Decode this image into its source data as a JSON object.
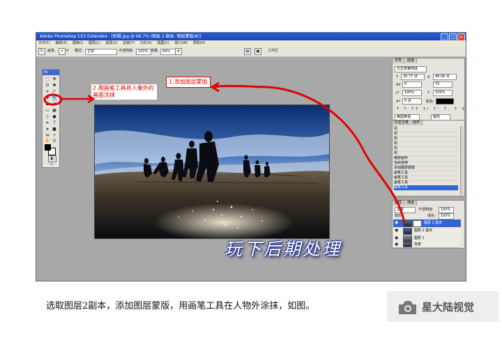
{
  "window": {
    "title": "Adobe Photoshop CS3 Extended - [拍摄.jpg @ 66.7% (图层 2 副本, 图层蒙版/8)]",
    "menu": [
      "文件(F)",
      "编辑(E)",
      "图像(I)",
      "图层(L)",
      "选择(S)",
      "滤镜(T)",
      "分析(A)",
      "视图(V)",
      "窗口(W)",
      "帮助(H)"
    ],
    "controls": {
      "minimize": "_",
      "maximize": "□",
      "close": "×"
    }
  },
  "options_bar": {
    "brush_label": "画笔:",
    "brush_size": "4",
    "mode_label": "模式:",
    "mode_value": "正常",
    "opacity_label": "不透明度:",
    "opacity_value": "100%",
    "flow_label": "流量:",
    "flow_value": "69%",
    "workspace_label": "工作区"
  },
  "toolbox": {
    "header": "Ps"
  },
  "character_panel": {
    "tabs": [
      "字符",
      "段落"
    ],
    "font_family": "方正祥隶简体",
    "font_size": "20.77 点",
    "leading": "48.06 点",
    "tracking": "0",
    "kerning": "75",
    "vscale": "100%",
    "hscale": "100%",
    "baseline": "0 点",
    "color_label": "颜色:",
    "language": "美国英语",
    "aa": "锐利"
  },
  "history_panel": {
    "tabs": [
      "历史记录",
      "动作"
    ],
    "items": [
      "风",
      "风",
      "风",
      "风",
      "风",
      "风",
      "缩放画布",
      "自由变换",
      "添加图层蒙版",
      "画笔工具",
      "画笔工具",
      "画笔工具",
      "画笔工具"
    ],
    "selected": "画笔工具"
  },
  "layers_panel": {
    "tabs": [
      "图层",
      "通道"
    ],
    "blend_mode": "正常",
    "opacity_label": "不透明度:",
    "opacity_value": "100%",
    "lock_label": "锁定:",
    "fill_label": "填充:",
    "fill_value": "100%",
    "layers": [
      {
        "name": "图层 2 副本",
        "selected": true
      },
      {
        "name": "图层 2 副本",
        "selected": false
      },
      {
        "name": "图层 1",
        "selected": false
      },
      {
        "name": "背景",
        "selected": false
      }
    ]
  },
  "annotations": {
    "step1": "1.添加图层蒙版",
    "step2": "2.用画笔工具将人像外的画面涂抹"
  },
  "overlay_title": "玩下后期处理",
  "caption": "选取图层2副本，添加图层蒙版，用画笔工具在人物外涂抹，如图。",
  "brand": "星大陆视觉",
  "colors": {
    "annotation": "#e10000",
    "titlebar": "#1a44b8",
    "selection": "#3165d4"
  }
}
